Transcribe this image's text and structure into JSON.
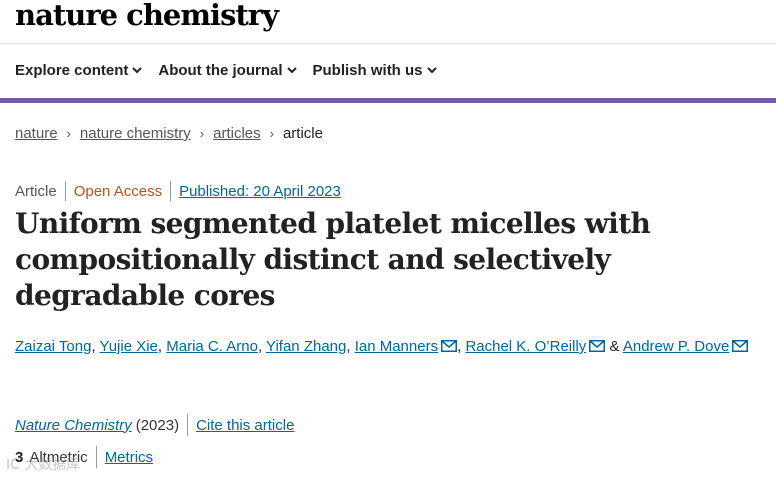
{
  "site": {
    "logo": "nature chemistry"
  },
  "nav": {
    "items": [
      {
        "label": "Explore content"
      },
      {
        "label": "About the journal"
      },
      {
        "label": "Publish with us"
      }
    ]
  },
  "breadcrumb": [
    "nature",
    "nature chemistry",
    "articles",
    "article"
  ],
  "article": {
    "type": "Article",
    "access": "Open Access",
    "published": "Published: 20 April 2023",
    "title": "Uniform segmented platelet micelles with compositionally distinct and selectively degradable cores",
    "authors": [
      {
        "name": "Zaizai Tong"
      },
      {
        "name": "Yujie Xie"
      },
      {
        "name": "Maria C. Arno"
      },
      {
        "name": "Yifan Zhang"
      },
      {
        "name": "Ian Manners",
        "email_icon": "envelope-icon"
      },
      {
        "name": "Rachel K. O’Reilly",
        "email_icon": "envelope-icon"
      },
      {
        "name": "Andrew P. Dove",
        "email_icon": "envelope-icon"
      }
    ],
    "authors_and": "&",
    "journal": "Nature Chemistry",
    "year": "(2023)",
    "cite_label": "Cite this article",
    "altmetric_count": "3",
    "altmetric_label": "Altmetric",
    "metrics_label": "Metrics"
  },
  "watermark": "IC 大数据库",
  "colors": {
    "accent_bar": "#7a5aa6",
    "link": "#006699",
    "open_access": "#b5541b"
  }
}
